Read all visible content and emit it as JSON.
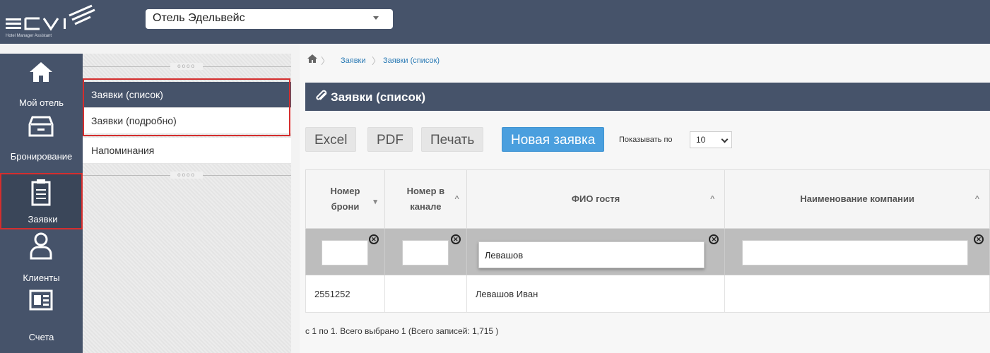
{
  "app": {
    "logo_text": "ECVI",
    "logo_tagline": "Hotel Manager Assistant",
    "hotel_selected": "Отель Эдельвейс",
    "accent": "#46536a",
    "highlight": "#d42e2e",
    "primary": "#4a9fde"
  },
  "nav": [
    {
      "label": "Мой отель",
      "icon": "home-icon"
    },
    {
      "label": "Бронирование",
      "icon": "archive-box-icon"
    },
    {
      "label": "Заявки",
      "icon": "clipboard-icon",
      "active": true
    },
    {
      "label": "Клиенты",
      "icon": "user-icon"
    },
    {
      "label": "Счета",
      "icon": "invoice-icon"
    }
  ],
  "submenu": {
    "items": [
      {
        "label": "Заявки (список)",
        "selected": true
      },
      {
        "label": "Заявки (подробно)"
      },
      {
        "label": "Напоминания"
      }
    ]
  },
  "breadcrumb": [
    "Заявки",
    "Заявки (список)"
  ],
  "page_title": "Заявки (список)",
  "toolbar": {
    "excel": "Excel",
    "pdf": "PDF",
    "print": "Печать",
    "new": "Новая заявка",
    "show_label": "Показывать по",
    "show_value": "10"
  },
  "table": {
    "columns": [
      {
        "line1": "Номер",
        "line2": "брони"
      },
      {
        "line1": "Номер в",
        "line2": "канале"
      },
      {
        "line1": "ФИО гостя",
        "line2": ""
      },
      {
        "line1": "Наименование компании",
        "line2": ""
      }
    ],
    "filters": [
      "",
      "",
      "Левашов",
      ""
    ],
    "rows": [
      [
        "2551252",
        "",
        "Левашов Иван",
        ""
      ]
    ]
  },
  "footer": "с 1 по 1. Всего выбрано 1 (Всего записей: 1,715 )"
}
